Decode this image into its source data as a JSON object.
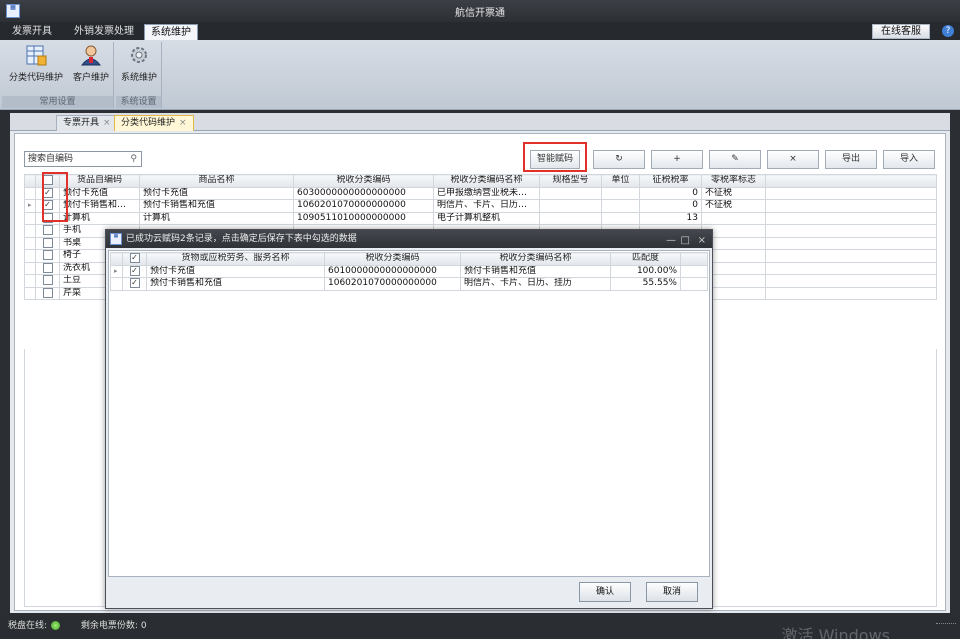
{
  "window": {
    "title": "航信开票通"
  },
  "menu": {
    "tabs": [
      {
        "label": "发票开具"
      },
      {
        "label": "外销发票处理"
      },
      {
        "label": "系统维护"
      }
    ],
    "online_service": "在线客服",
    "help_icon": "?"
  },
  "ribbon": {
    "buttons": [
      {
        "label": "分类代码维护",
        "icon": "table-icon"
      },
      {
        "label": "客户维护",
        "icon": "user-icon"
      },
      {
        "label": "系统维护",
        "icon": "gear-icon"
      }
    ],
    "groups": [
      {
        "label": "常用设置"
      },
      {
        "label": "系统设置"
      }
    ]
  },
  "doc_tabs": [
    {
      "label": "专票开具",
      "close": "×"
    },
    {
      "label": "分类代码维护",
      "close": "×"
    }
  ],
  "toolbar": {
    "search_placeholder": "搜索自编码",
    "smart_code_label": "智能赋码",
    "refresh_icon": "↻",
    "add_label": "+",
    "edit_label": "✎",
    "delete_label": "×",
    "export_label": "导出",
    "import_label": "导入"
  },
  "main_grid": {
    "columns": [
      "",
      "货品自编码",
      "商品名称",
      "税收分类编码",
      "税收分类编码名称",
      "规格型号",
      "单位",
      "征税税率",
      "零税率标志"
    ],
    "rows": [
      {
        "checked": true,
        "code": "预付卡充值",
        "name": "预付卡充值",
        "tax_code": "6030000000000000000",
        "tax_name": "已申报缴纳营业税未…",
        "spec": "",
        "unit": "",
        "rate": "0",
        "zero_flag": "不征税"
      },
      {
        "checked": true,
        "code": "预付卡销售和…",
        "name": "预付卡销售和充值",
        "tax_code": "1060201070000000000",
        "tax_name": "明信片、卡片、日历…",
        "spec": "",
        "unit": "",
        "rate": "0",
        "zero_flag": "不征税"
      },
      {
        "checked": false,
        "code": "计算机",
        "name": "计算机",
        "tax_code": "1090511010000000000",
        "tax_name": "电子计算机整机",
        "spec": "",
        "unit": "",
        "rate": "13",
        "zero_flag": ""
      },
      {
        "checked": false,
        "code": "手机",
        "name": "",
        "tax_code": "",
        "tax_name": "",
        "spec": "",
        "unit": "",
        "rate": "",
        "zero_flag": ""
      },
      {
        "checked": false,
        "code": "书桌",
        "name": "",
        "tax_code": "",
        "tax_name": "",
        "spec": "",
        "unit": "",
        "rate": "",
        "zero_flag": ""
      },
      {
        "checked": false,
        "code": "椅子",
        "name": "",
        "tax_code": "",
        "tax_name": "",
        "spec": "",
        "unit": "",
        "rate": "",
        "zero_flag": ""
      },
      {
        "checked": false,
        "code": "洗衣机",
        "name": "",
        "tax_code": "",
        "tax_name": "",
        "spec": "",
        "unit": "",
        "rate": "",
        "zero_flag": ""
      },
      {
        "checked": false,
        "code": "土豆",
        "name": "",
        "tax_code": "",
        "tax_name": "",
        "spec": "",
        "unit": "",
        "rate": "",
        "zero_flag": ""
      },
      {
        "checked": false,
        "code": "芹菜",
        "name": "",
        "tax_code": "",
        "tax_name": "",
        "spec": "",
        "unit": "",
        "rate": "",
        "zero_flag": ""
      }
    ]
  },
  "dialog": {
    "title": "已成功云赋码2条记录，点击确定后保存下表中勾选的数据",
    "controls": {
      "minimize": "—",
      "maximize": "□",
      "close": "×"
    },
    "columns": [
      "",
      "货物或应税劳务、服务名称",
      "税收分类编码",
      "税收分类编码名称",
      "匹配度"
    ],
    "rows": [
      {
        "checked": true,
        "name": "预付卡充值",
        "tax_code": "6010000000000000000",
        "tax_name": "预付卡销售和充值",
        "match": "100.00%"
      },
      {
        "checked": true,
        "name": "预付卡销售和充值",
        "tax_code": "1060201070000000000",
        "tax_name": "明信片、卡片、日历、挂历",
        "match": "55.55%"
      }
    ],
    "confirm_label": "确认",
    "cancel_label": "取消"
  },
  "status": {
    "tax_disk_label": "税盘在线:",
    "remaining_label": "剩余电票份数: 0",
    "watermark": "激活 Windows"
  }
}
